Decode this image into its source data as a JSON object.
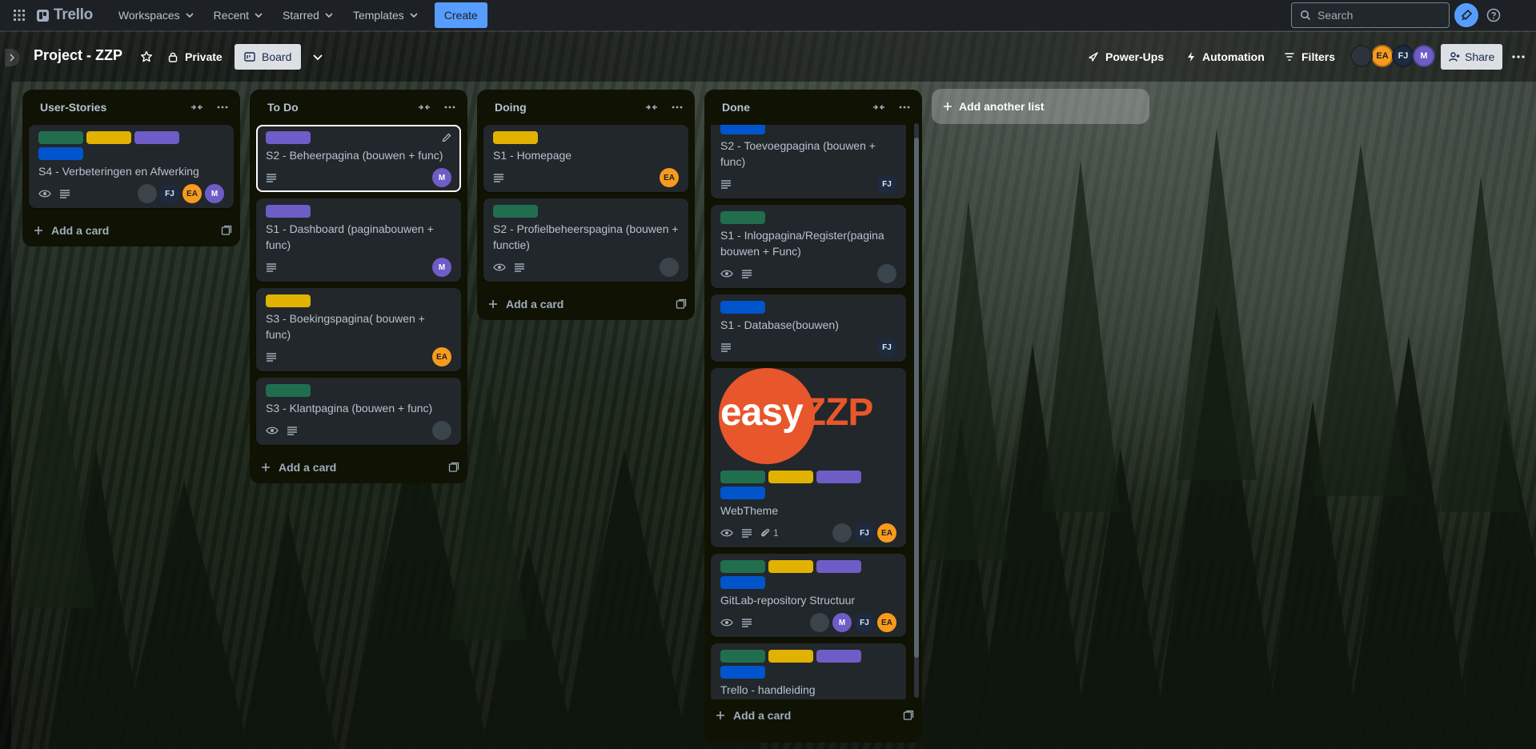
{
  "topnav": {
    "logo": "Trello",
    "menu": [
      {
        "label": "Workspaces"
      },
      {
        "label": "Recent"
      },
      {
        "label": "Starred"
      },
      {
        "label": "Templates"
      }
    ],
    "create_label": "Create",
    "search_placeholder": "Search"
  },
  "board": {
    "title": "Project - ZZP",
    "visibility": "Private",
    "view_label": "Board",
    "powerups": "Power-Ups",
    "automation": "Automation",
    "filters": "Filters",
    "share": "Share",
    "members": [
      "EA",
      "FJ",
      "M"
    ]
  },
  "label_colors": {
    "green": "#216e4e",
    "yellow": "#e2b203",
    "purple": "#6e5dc6",
    "blue": "#0055cc"
  },
  "lists": [
    {
      "title": "User-Stories",
      "add_card": "Add a card",
      "cards": [
        {
          "title": "S4 - Verbeteringen en Afwerking",
          "labels": [
            "green",
            "yellow",
            "purple",
            "blue"
          ],
          "badges": [
            "eye-icon",
            "description-icon"
          ],
          "members": [
            "blank",
            "FJ",
            "EA",
            "M"
          ]
        }
      ]
    },
    {
      "title": "To Do",
      "add_card": "Add a card",
      "cards": [
        {
          "title": "S2 - Beheerpagina (bouwen + func)",
          "labels": [
            "purple"
          ],
          "badges": [
            "description-icon"
          ],
          "members": [
            "M"
          ]
        },
        {
          "title": "S1 - Dashboard (paginabouwen + func)",
          "labels": [
            "purple"
          ],
          "badges": [
            "description-icon"
          ],
          "members": [
            "M"
          ]
        },
        {
          "title": "S3 - Boekingspagina( bouwen + func)",
          "labels": [
            "yellow"
          ],
          "badges": [
            "description-icon"
          ],
          "members": [
            "EA"
          ]
        },
        {
          "title": "S3 - Klantpagina (bouwen + func)",
          "labels": [
            "green"
          ],
          "badges": [
            "eye-icon",
            "description-icon"
          ],
          "members": [
            "blank"
          ]
        }
      ]
    },
    {
      "title": "Doing",
      "add_card": "Add a card",
      "cards": [
        {
          "title": "S1 - Homepage",
          "labels": [
            "yellow"
          ],
          "badges": [
            "description-icon"
          ],
          "members": [
            "EA"
          ]
        },
        {
          "title": "S2 - Profielbeheerspagina (bouwen + functie)",
          "labels": [
            "green"
          ],
          "badges": [
            "eye-icon",
            "description-icon"
          ],
          "members": [
            "blank"
          ]
        }
      ]
    },
    {
      "title": "Done",
      "add_card": "Add a card",
      "cards": [
        {
          "title": "S2 - Toevoegpagina (bouwen + func)",
          "labels": [
            "blue"
          ],
          "badges": [
            "description-icon"
          ],
          "members": [
            "FJ"
          ]
        },
        {
          "title": "S1 - Inlogpagina/Register(pagina bouwen + Func)",
          "labels": [
            "green"
          ],
          "badges": [
            "eye-icon",
            "description-icon"
          ],
          "members": [
            "blank"
          ]
        },
        {
          "title": "S1 - Database(bouwen)",
          "labels": [
            "blue"
          ],
          "badges": [
            "description-icon"
          ],
          "members": [
            "FJ"
          ]
        },
        {
          "title": "WebTheme",
          "cover": {
            "easy": "easy",
            "zzp": "ZZP"
          },
          "labels": [
            "green",
            "yellow",
            "purple",
            "blue"
          ],
          "badges": [
            "eye-icon",
            "description-icon"
          ],
          "attachments": "1",
          "members": [
            "blank",
            "FJ",
            "EA"
          ]
        },
        {
          "title": "GitLab-repository Structuur",
          "labels": [
            "green",
            "yellow",
            "purple",
            "blue"
          ],
          "badges": [
            "eye-icon",
            "description-icon"
          ],
          "members": [
            "blank",
            "M",
            "FJ",
            "EA"
          ]
        },
        {
          "title": "Trello - handleiding",
          "labels": [
            "green",
            "yellow",
            "purple",
            "blue"
          ],
          "badges": [],
          "members": []
        }
      ]
    }
  ],
  "add_list": "Add another list"
}
